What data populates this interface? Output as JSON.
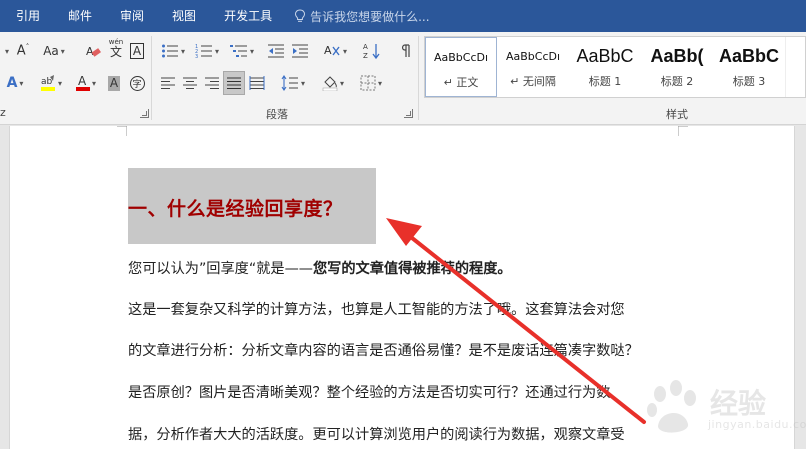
{
  "tabs": [
    {
      "label": "引用"
    },
    {
      "label": "邮件"
    },
    {
      "label": "审阅"
    },
    {
      "label": "视图"
    },
    {
      "label": "开发工具"
    }
  ],
  "tell_me": {
    "placeholder": "告诉我您想要做什么..."
  },
  "ribbon": {
    "groups": {
      "paragraph": "段落",
      "styles": "样式",
      "font_partial": "z"
    },
    "font": {
      "change_case": "Aa",
      "phonetic": "wén",
      "phonetic_char": "文",
      "border_char": "A",
      "shade_char": "A",
      "enclose_char": "字"
    },
    "styles": [
      {
        "preview": "AaBbCcDı",
        "name": "↵ 正文",
        "kind": "normal"
      },
      {
        "preview": "AaBbCcDı",
        "name": "↵ 无间隔",
        "kind": "normal"
      },
      {
        "preview": "AaBbC",
        "name": "标题 1",
        "kind": "h1"
      },
      {
        "preview": "AaBb(",
        "name": "标题 2",
        "kind": "h2"
      },
      {
        "preview": "AaBbC",
        "name": "标题 3",
        "kind": "h3"
      }
    ]
  },
  "document": {
    "heading": "一、什么是经验回享度？",
    "lines": [
      {
        "normal": "您可以认为”回享度“就是——",
        "bold": "您写的文章值得被推荐的程度。"
      },
      {
        "normal": "这是一套复杂又科学的计算方法，也算是人工智能的方法了哦。这套算法会对您",
        "bold": ""
      },
      {
        "normal": "的文章进行分析：分析文章内容的语言是否通俗易懂？是不是废话连篇凑字数哒？",
        "bold": ""
      },
      {
        "normal": "是否原创？图片是否清晰美观？整个经验的方法是否切实可行？还通过行为数",
        "bold": ""
      },
      {
        "normal": "据，分析作者大大的活跃度。更可以计算浏览用户的阅读行为数据，观察文章受",
        "bold": ""
      }
    ]
  },
  "watermark": {
    "text": "经验",
    "sub": "jingyan.baidu.com"
  },
  "colors": {
    "tab_bar": "#2b579a",
    "heading": "#a00000",
    "arrow": "#e8302a",
    "highlight": "#c8c8c8"
  }
}
